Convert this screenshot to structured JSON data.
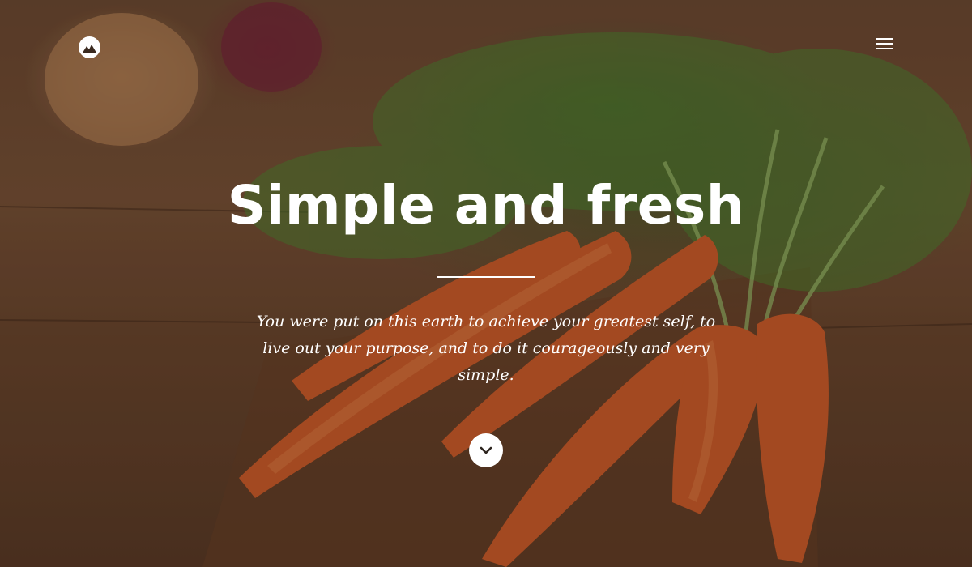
{
  "hero": {
    "title": "Simple and fresh",
    "tagline": "You were put on this earth to achieve your greatest self, to live out your purpose, and to do it courageously and very simple."
  },
  "icons": {
    "logo": "mountain-logo-icon",
    "menu": "hamburger-menu-icon",
    "scroll": "chevron-down-icon"
  },
  "colors": {
    "text": "#ffffff",
    "carrot": "#e0632a",
    "leaf": "#4f8a32",
    "wood": "#7a5236"
  }
}
